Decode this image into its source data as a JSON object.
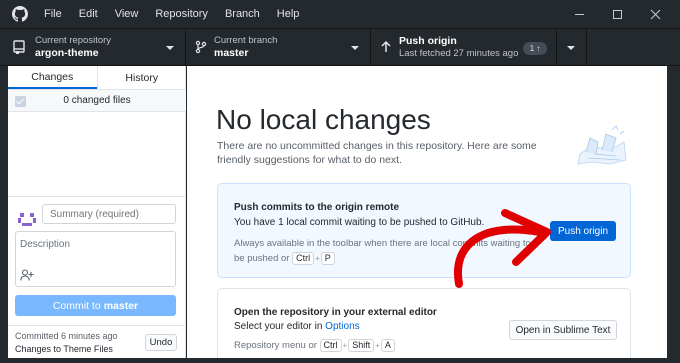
{
  "menu": [
    "File",
    "Edit",
    "View",
    "Repository",
    "Branch",
    "Help"
  ],
  "toolbar": {
    "repo_label": "Current repository",
    "repo_value": "argon-theme",
    "branch_label": "Current branch",
    "branch_value": "master",
    "push_label": "Push origin",
    "push_sub": "Last fetched 27 minutes ago",
    "push_badge": "1"
  },
  "sidebar": {
    "tab_changes": "Changes",
    "tab_history": "History",
    "changed_files": "0 changed files",
    "summary_placeholder": "Summary (required)",
    "description_placeholder": "Description",
    "commit_prefix": "Commit to",
    "commit_branch": "master",
    "last_commit_time": "Committed 6 minutes ago",
    "last_commit_msg": "Changes to Theme Files",
    "undo_label": "Undo"
  },
  "main": {
    "title": "No local changes",
    "subtitle": "There are no uncommitted changes in this repository. Here are some friendly suggestions for what to do next.",
    "push_card": {
      "title": "Push commits to the origin remote",
      "desc": "You have 1 local commit waiting to be pushed to GitHub.",
      "note_pre": "Always available in the toolbar when there are local commits waiting to be pushed or",
      "key1": "Ctrl",
      "key2": "P",
      "button": "Push origin"
    },
    "editor_card": {
      "title": "Open the repository in your external editor",
      "desc_pre": "Select your editor in",
      "desc_link": "Options",
      "note_pre": "Repository menu or",
      "key1": "Ctrl",
      "key2": "Shift",
      "key3": "A",
      "button": "Open in Sublime Text"
    }
  },
  "colors": {
    "accent": "#0366d6",
    "annotation": "#e00000",
    "toolbar_bg": "#24292e"
  }
}
